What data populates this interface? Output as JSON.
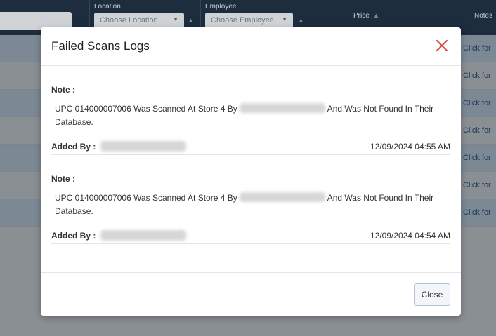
{
  "background": {
    "columns": {
      "location_label": "Location",
      "location_placeholder": "Choose Location",
      "employee_label": "Employee",
      "employee_placeholder": "Choose Employee",
      "price_label": "Price",
      "notes_label": "Notes"
    },
    "rows": [
      {
        "link": "Click for"
      },
      {
        "link": "Click for"
      },
      {
        "link": "Click for"
      },
      {
        "link": "Click for"
      },
      {
        "link": "Click for"
      },
      {
        "link": "Click for"
      },
      {
        "link": "Click for"
      }
    ]
  },
  "modal": {
    "title": "Failed Scans Logs",
    "close_button": "Close",
    "entries": [
      {
        "note_label": "Note :",
        "note_before": "UPC 014000007006 Was Scanned At Store 4 By ",
        "note_after": " And Was Not Found In Their Database.",
        "added_label": "Added By :",
        "timestamp": "12/09/2024 04:55 AM"
      },
      {
        "note_label": "Note :",
        "note_before": "UPC 014000007006 Was Scanned At Store 4 By ",
        "note_after": " And Was Not Found In Their Database.",
        "added_label": "Added By :",
        "timestamp": "12/09/2024 04:54 AM"
      }
    ]
  },
  "colors": {
    "close_icon": "#d9534f",
    "header_bg": "#1d2d3e"
  },
  "icons": [
    "close-icon",
    "sort-icon",
    "chevron-down-icon"
  ]
}
